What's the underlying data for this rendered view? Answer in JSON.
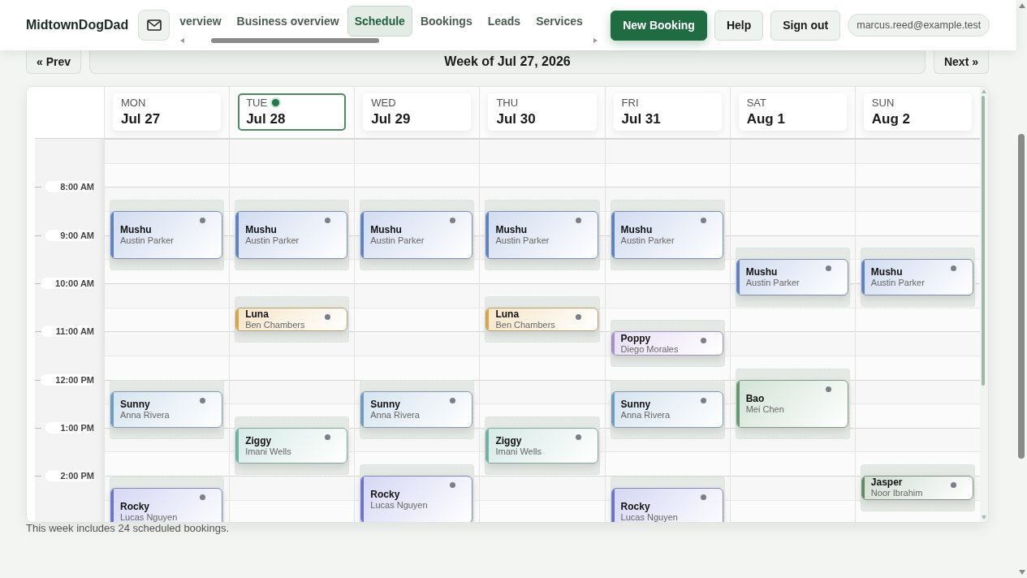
{
  "brand": "MidtownDogDad",
  "nav": {
    "tabs": [
      {
        "label": "verview",
        "selected": false
      },
      {
        "label": "Business overview",
        "selected": false
      },
      {
        "label": "Schedule",
        "selected": true
      },
      {
        "label": "Bookings",
        "selected": false
      },
      {
        "label": "Leads",
        "selected": false
      },
      {
        "label": "Services",
        "selected": false
      }
    ]
  },
  "actions": [
    {
      "label": "New Booking",
      "kind": "primary"
    },
    {
      "label": "Help",
      "kind": "secondary"
    },
    {
      "label": "Sign out",
      "kind": "secondary"
    }
  ],
  "user_email": "marcus.reed@example.test",
  "week": {
    "prev": "« Prev",
    "title": "Week of Jul 27, 2026",
    "next": "Next »"
  },
  "time_labels": [
    "8:00 AM",
    "9:00 AM",
    "10:00 AM",
    "11:00 AM",
    "12:00 PM",
    "1:00 PM",
    "2:00 PM"
  ],
  "days": [
    {
      "weekday": "MON",
      "date": "Jul 27",
      "today": false,
      "bookings": [
        {
          "pet": "Mushu",
          "owner": "Austin Parker",
          "color": "#5a80c8"
        },
        {
          "pet": "Sunny",
          "owner": "Anna Rivera",
          "color": "#6a9cc8"
        },
        {
          "pet": "Rocky",
          "owner": "Lucas Nguyen",
          "color": "#6a70d8"
        }
      ]
    },
    {
      "weekday": "TUE",
      "date": "Jul 28",
      "today": true,
      "bookings": [
        {
          "pet": "Mushu",
          "owner": "Austin Parker",
          "color": "#5a80c8"
        },
        {
          "pet": "Luna",
          "owner": "Ben Chambers",
          "color": "#e0a43a"
        },
        {
          "pet": "Ziggy",
          "owner": "Imani Wells",
          "color": "#6bb3a3"
        }
      ]
    },
    {
      "weekday": "WED",
      "date": "Jul 29",
      "today": false,
      "bookings": [
        {
          "pet": "Mushu",
          "owner": "Austin Parker",
          "color": "#5a80c8"
        },
        {
          "pet": "Sunny",
          "owner": "Anna Rivera",
          "color": "#6a9cc8"
        },
        {
          "pet": "Rocky",
          "owner": "Lucas Nguyen",
          "color": "#6a70d8"
        }
      ]
    },
    {
      "weekday": "THU",
      "date": "Jul 30",
      "today": false,
      "bookings": [
        {
          "pet": "Mushu",
          "owner": "Austin Parker",
          "color": "#5a80c8"
        },
        {
          "pet": "Luna",
          "owner": "Ben Chambers",
          "color": "#e0a43a"
        },
        {
          "pet": "Ziggy",
          "owner": "Imani Wells",
          "color": "#6bb3a3"
        }
      ]
    },
    {
      "weekday": "FRI",
      "date": "Jul 31",
      "today": false,
      "bookings": [
        {
          "pet": "Mushu",
          "owner": "Austin Parker",
          "color": "#5a80c8"
        },
        {
          "pet": "Poppy",
          "owner": "Diego Morales",
          "color": "#a98ad8"
        },
        {
          "pet": "Sunny",
          "owner": "Anna Rivera",
          "color": "#6a9cc8"
        },
        {
          "pet": "Rocky",
          "owner": "Lucas Nguyen",
          "color": "#6a70d8"
        }
      ]
    },
    {
      "weekday": "SAT",
      "date": "Aug 1",
      "today": false,
      "bookings": [
        {
          "pet": "Mushu",
          "owner": "Austin Parker",
          "color": "#5a80c8"
        },
        {
          "pet": "Bao",
          "owner": "Mei Chen",
          "color": "#5e9a6a"
        }
      ]
    },
    {
      "weekday": "SUN",
      "date": "Aug 2",
      "today": false,
      "bookings": [
        {
          "pet": "Mushu",
          "owner": "Austin Parker",
          "color": "#5a80c8"
        },
        {
          "pet": "Jasper",
          "owner": "Noor Ibrahim",
          "color": "#5e8a60"
        }
      ]
    }
  ],
  "summary": "This week includes 24 scheduled bookings."
}
